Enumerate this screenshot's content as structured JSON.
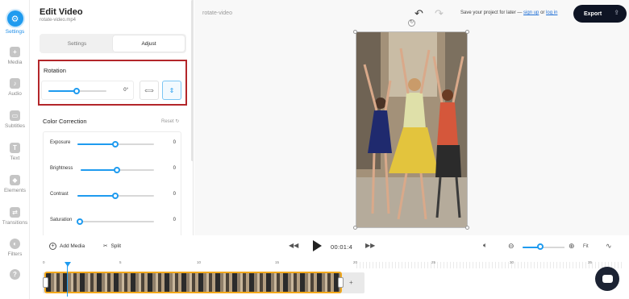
{
  "rail": [
    {
      "label": "Settings",
      "icon": "gear-icon",
      "active": true
    },
    {
      "label": "Media",
      "icon": "media-icon"
    },
    {
      "label": "Audio",
      "icon": "audio-icon"
    },
    {
      "label": "Subtitles",
      "icon": "subtitles-icon"
    },
    {
      "label": "Text",
      "icon": "text-icon"
    },
    {
      "label": "Elements",
      "icon": "elements-icon"
    },
    {
      "label": "Transitions",
      "icon": "transitions-icon"
    },
    {
      "label": "Filters",
      "icon": "filters-icon"
    },
    {
      "label": "",
      "icon": "help-icon"
    }
  ],
  "panel": {
    "title": "Edit Video",
    "filename": "rotate-video.mp4",
    "tabs": [
      "Settings",
      "Adjust"
    ],
    "active_tab": "Adjust",
    "rotation": {
      "label": "Rotation",
      "value": "0°",
      "level": 0.5
    },
    "color_correction": {
      "title": "Color Correction",
      "reset": "Reset",
      "rows": [
        {
          "label": "Exposure",
          "value": "0",
          "level": 0.5
        },
        {
          "label": "Brightness",
          "value": "0",
          "level": 0.5
        },
        {
          "label": "Contrast",
          "value": "0",
          "level": 0.5
        },
        {
          "label": "Saturation",
          "value": "0",
          "level": 0.0
        }
      ]
    }
  },
  "topbar": {
    "project_name": "rotate-video",
    "save_text": "Save your project for later —",
    "sign_up": "sign up",
    "or": "or",
    "log_in": "log in",
    "export_label": "Export"
  },
  "controls": {
    "add_media": "Add Media",
    "split": "Split",
    "time": "00:01:4",
    "fit": "Fit",
    "zoom_level": 0.45
  },
  "timeline": {
    "ticks": [
      "0",
      "5",
      "10",
      "15",
      "20",
      "25",
      "30",
      "35"
    ]
  },
  "colors": {
    "accent": "#1f9bef",
    "highlight_border": "#b3262a",
    "clip_border": "#f2a81b",
    "export_bg": "#0e1424"
  }
}
